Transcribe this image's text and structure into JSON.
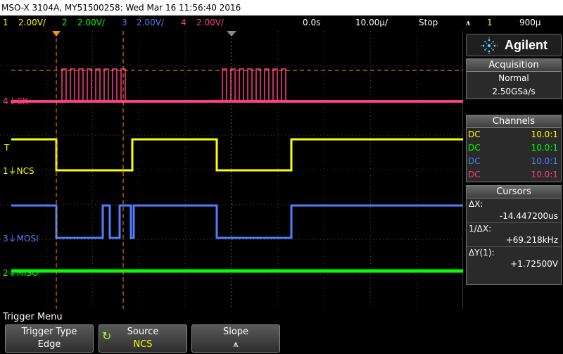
{
  "title_bar": {
    "text": "MSO-X 3104A, MY51500258: Wed Mar 16 11:56:40 2016"
  },
  "status_bar": {
    "channels": [
      {
        "num": "1",
        "scale": "2.00V/",
        "color": "#ffff00"
      },
      {
        "num": "2",
        "scale": "2.00V/",
        "color": "#00ff00"
      },
      {
        "num": "3",
        "scale": "2.00V/",
        "color": "#4f7fff"
      },
      {
        "num": "4",
        "scale": "2.00V/",
        "color": "#ff3d8b"
      }
    ],
    "delay": "0.0s",
    "timebase": "10.00µ/",
    "run_state": "Stop",
    "trigger_source": "1",
    "trigger_level": "900µ"
  },
  "waveform_labels": {
    "ck": {
      "num": "4",
      "name": "CK"
    },
    "ncs": {
      "num": "1",
      "name": "NCS"
    },
    "mosi": {
      "num": "3",
      "name": "MOSI"
    },
    "miso": {
      "num": "2",
      "name": "MISO"
    },
    "trig_marker": "T"
  },
  "brand": {
    "name": "Agilent",
    "logo": "agilent-spark-logo"
  },
  "acquisition": {
    "header": "Acquisition",
    "mode": "Normal",
    "rate": "2.50GSa/s"
  },
  "channels_panel": {
    "header": "Channels",
    "rows": [
      {
        "coupling": "DC",
        "ratio": "10.0:1",
        "color": "#ffff00"
      },
      {
        "coupling": "DC",
        "ratio": "10.0:1",
        "color": "#00ff00"
      },
      {
        "coupling": "DC",
        "ratio": "10.0:1",
        "color": "#4f7fff"
      },
      {
        "coupling": "DC",
        "ratio": "10.0:1",
        "color": "#ff3d8b"
      }
    ]
  },
  "cursors": {
    "header": "Cursors",
    "dx_label": "ΔX:",
    "dx_value": "-14.447200us",
    "inv_dx_label": "1/ΔX:",
    "inv_dx_value": "+69.218kHz",
    "dy_label": "ΔY(1):",
    "dy_value": "+1.72500V"
  },
  "menu": {
    "title": "Trigger Menu",
    "softkeys": [
      {
        "label": "Trigger Type",
        "value": "Edge"
      },
      {
        "label": "Source",
        "value": "NCS"
      },
      {
        "label": "Slope",
        "value": "⩚"
      }
    ]
  },
  "colors": {
    "ch1": "#ffff00",
    "ch2": "#00ff00",
    "ch3": "#4f7fff",
    "ch4": "#ff3d8b",
    "cursor": "#ff8c1a",
    "grid": "#4a4a4a",
    "accent_value": "#ffff00"
  }
}
